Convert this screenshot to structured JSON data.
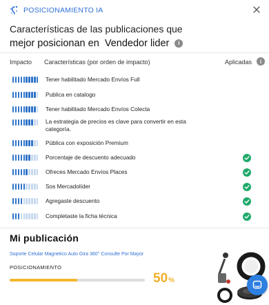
{
  "app": {
    "title": "POSICIONAMIENTO IA"
  },
  "heading": {
    "line1": "Características de las publicaciones que",
    "line2": "mejor posicionan en  Vendedor lider"
  },
  "columns": {
    "impacto": "Impacto",
    "caracteristicas": "Características (por orden de impacto)",
    "aplicadas": "Aplicadas"
  },
  "features": [
    {
      "label": "Tener habilitado Mercado Envíos Full",
      "impact": 10,
      "applied": false
    },
    {
      "label": "Publica en catalogo",
      "impact": 9,
      "applied": false
    },
    {
      "label": "Tener habilitado Mercado Envíos Colecta",
      "impact": 9,
      "applied": false
    },
    {
      "label": "La estrategia de precios es clave para convertir en esta categoría.",
      "impact": 8,
      "applied": false
    },
    {
      "label": "Pública con exposición Premium",
      "impact": 8,
      "applied": false
    },
    {
      "label": "Porcentaje de descuento adecuado",
      "impact": 7,
      "applied": true
    },
    {
      "label": "Ofreces Mercado Envíos Places",
      "impact": 6,
      "applied": true
    },
    {
      "label": "Sos Mercadolíder",
      "impact": 5,
      "applied": true
    },
    {
      "label": "Agregaste descuento",
      "impact": 4,
      "applied": true
    },
    {
      "label": "Completaste la ficha técnica",
      "impact": 3,
      "applied": true
    }
  ],
  "publication": {
    "section_title": "Mi publicación",
    "title": "Soporte Celular Magnetico Auto Gira 360° Consulte Por Mayor",
    "positioning_label": "POSICIONAMIENTO",
    "positioning_value": "50",
    "positioning_symbol": "%",
    "positioning_fraction": 0.5
  },
  "colors": {
    "accent": "#2f6fd6",
    "bar_on": "#2f74c9",
    "bar_off": "#c7d8ee",
    "check": "#1fa96b",
    "progress": "#f5b72e"
  },
  "icons": {
    "brand": "ai-sparkle-icon",
    "close": "close-icon",
    "info": "info-icon",
    "check": "check-circle-icon",
    "chat": "chat-icon"
  }
}
